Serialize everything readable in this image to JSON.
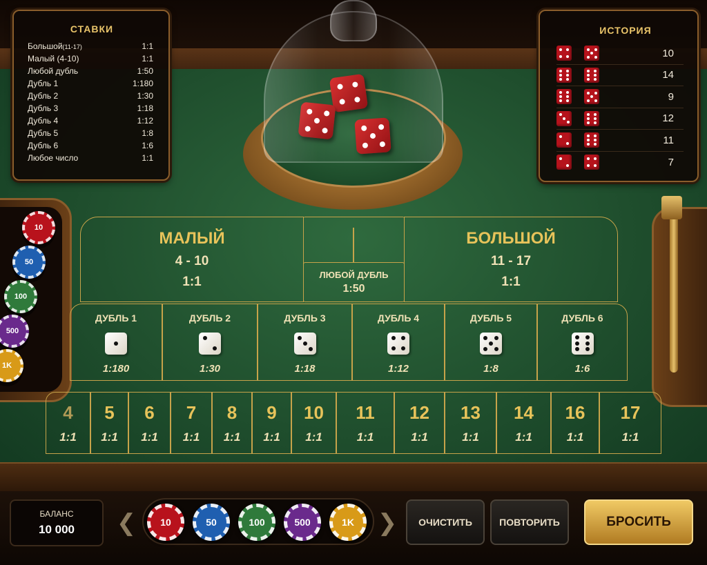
{
  "stakes": {
    "title": "СТАВКИ",
    "rows": [
      {
        "name": "Большой",
        "note": "(11-17)",
        "odds": "1:1"
      },
      {
        "name": "Малый (4-10)",
        "note": "",
        "odds": "1:1"
      },
      {
        "name": "Любой дубль",
        "note": "",
        "odds": "1:50"
      },
      {
        "name": "Дубль 1",
        "note": "",
        "odds": "1:180"
      },
      {
        "name": "Дубль 2",
        "note": "",
        "odds": "1:30"
      },
      {
        "name": "Дубль 3",
        "note": "",
        "odds": "1:18"
      },
      {
        "name": "Дубль 4",
        "note": "",
        "odds": "1:12"
      },
      {
        "name": "Дубль 5",
        "note": "",
        "odds": "1:8"
      },
      {
        "name": "Дубль 6",
        "note": "",
        "odds": "1:6"
      },
      {
        "name": "Любое число",
        "note": "",
        "odds": "1:1"
      }
    ]
  },
  "history": {
    "title": "ИСТОРИЯ",
    "rows": [
      {
        "dice": [
          4,
          5
        ],
        "total": "10"
      },
      {
        "dice": [
          6,
          6
        ],
        "total": "14"
      },
      {
        "dice": [
          6,
          5
        ],
        "total": "9"
      },
      {
        "dice": [
          3,
          6
        ],
        "total": "12"
      },
      {
        "dice": [
          2,
          6
        ],
        "total": "11"
      },
      {
        "dice": [
          2,
          4
        ],
        "total": "7"
      }
    ]
  },
  "dome_dice": [
    4,
    5,
    5
  ],
  "layout": {
    "small": {
      "title": "МАЛЫЙ",
      "range": "4 - 10",
      "odds": "1:1"
    },
    "big": {
      "title": "БОЛЬШОЙ",
      "range": "11 - 17",
      "odds": "1:1"
    },
    "any_double": {
      "label": "ЛЮБОЙ ДУБЛЬ",
      "odds": "1:50"
    },
    "doubles": [
      {
        "label": "ДУБЛЬ 1",
        "face": 1,
        "odds": "1:180"
      },
      {
        "label": "ДУБЛЬ 2",
        "face": 2,
        "odds": "1:30"
      },
      {
        "label": "ДУБЛЬ 3",
        "face": 3,
        "odds": "1:18"
      },
      {
        "label": "ДУБЛЬ 4",
        "face": 4,
        "odds": "1:12"
      },
      {
        "label": "ДУБЛЬ 5",
        "face": 5,
        "odds": "1:8"
      },
      {
        "label": "ДУБЛЬ 6",
        "face": 6,
        "odds": "1:6"
      }
    ],
    "sums": [
      {
        "n": "4",
        "odds": "1:1"
      },
      {
        "n": "5",
        "odds": "1:1"
      },
      {
        "n": "6",
        "odds": "1:1"
      },
      {
        "n": "7",
        "odds": "1:1"
      },
      {
        "n": "8",
        "odds": "1:1"
      },
      {
        "n": "9",
        "odds": "1:1"
      },
      {
        "n": "10",
        "odds": "1:1"
      },
      {
        "n": "11",
        "odds": "1:1"
      },
      {
        "n": "12",
        "odds": "1:1"
      },
      {
        "n": "13",
        "odds": "1:1"
      },
      {
        "n": "14",
        "odds": "1:1"
      },
      {
        "n": "16",
        "odds": "1:1"
      },
      {
        "n": "17",
        "odds": "1:1"
      }
    ]
  },
  "tray_chips": [
    {
      "label": "10",
      "color": "#b8121c"
    },
    {
      "label": "50",
      "color": "#1f5fb0"
    },
    {
      "label": "100",
      "color": "#2f7a3b"
    },
    {
      "label": "500",
      "color": "#6a2a8c"
    },
    {
      "label": "1K",
      "color": "#d89a18"
    }
  ],
  "controls": {
    "balance_label": "БАЛАНС",
    "balance_value": "10 000",
    "chips": [
      {
        "label": "10",
        "color": "#b8121c"
      },
      {
        "label": "50",
        "color": "#1f5fb0"
      },
      {
        "label": "100",
        "color": "#2f7a3b"
      },
      {
        "label": "500",
        "color": "#6a2a8c"
      },
      {
        "label": "1K",
        "color": "#d89a18"
      }
    ],
    "clear_label": "ОЧИСТИТЬ",
    "repeat_label": "ПОВТОРИТЬ",
    "roll_label": "БРОСИТЬ",
    "prev_icon": "chevron-left-icon",
    "next_icon": "chevron-right-icon"
  }
}
